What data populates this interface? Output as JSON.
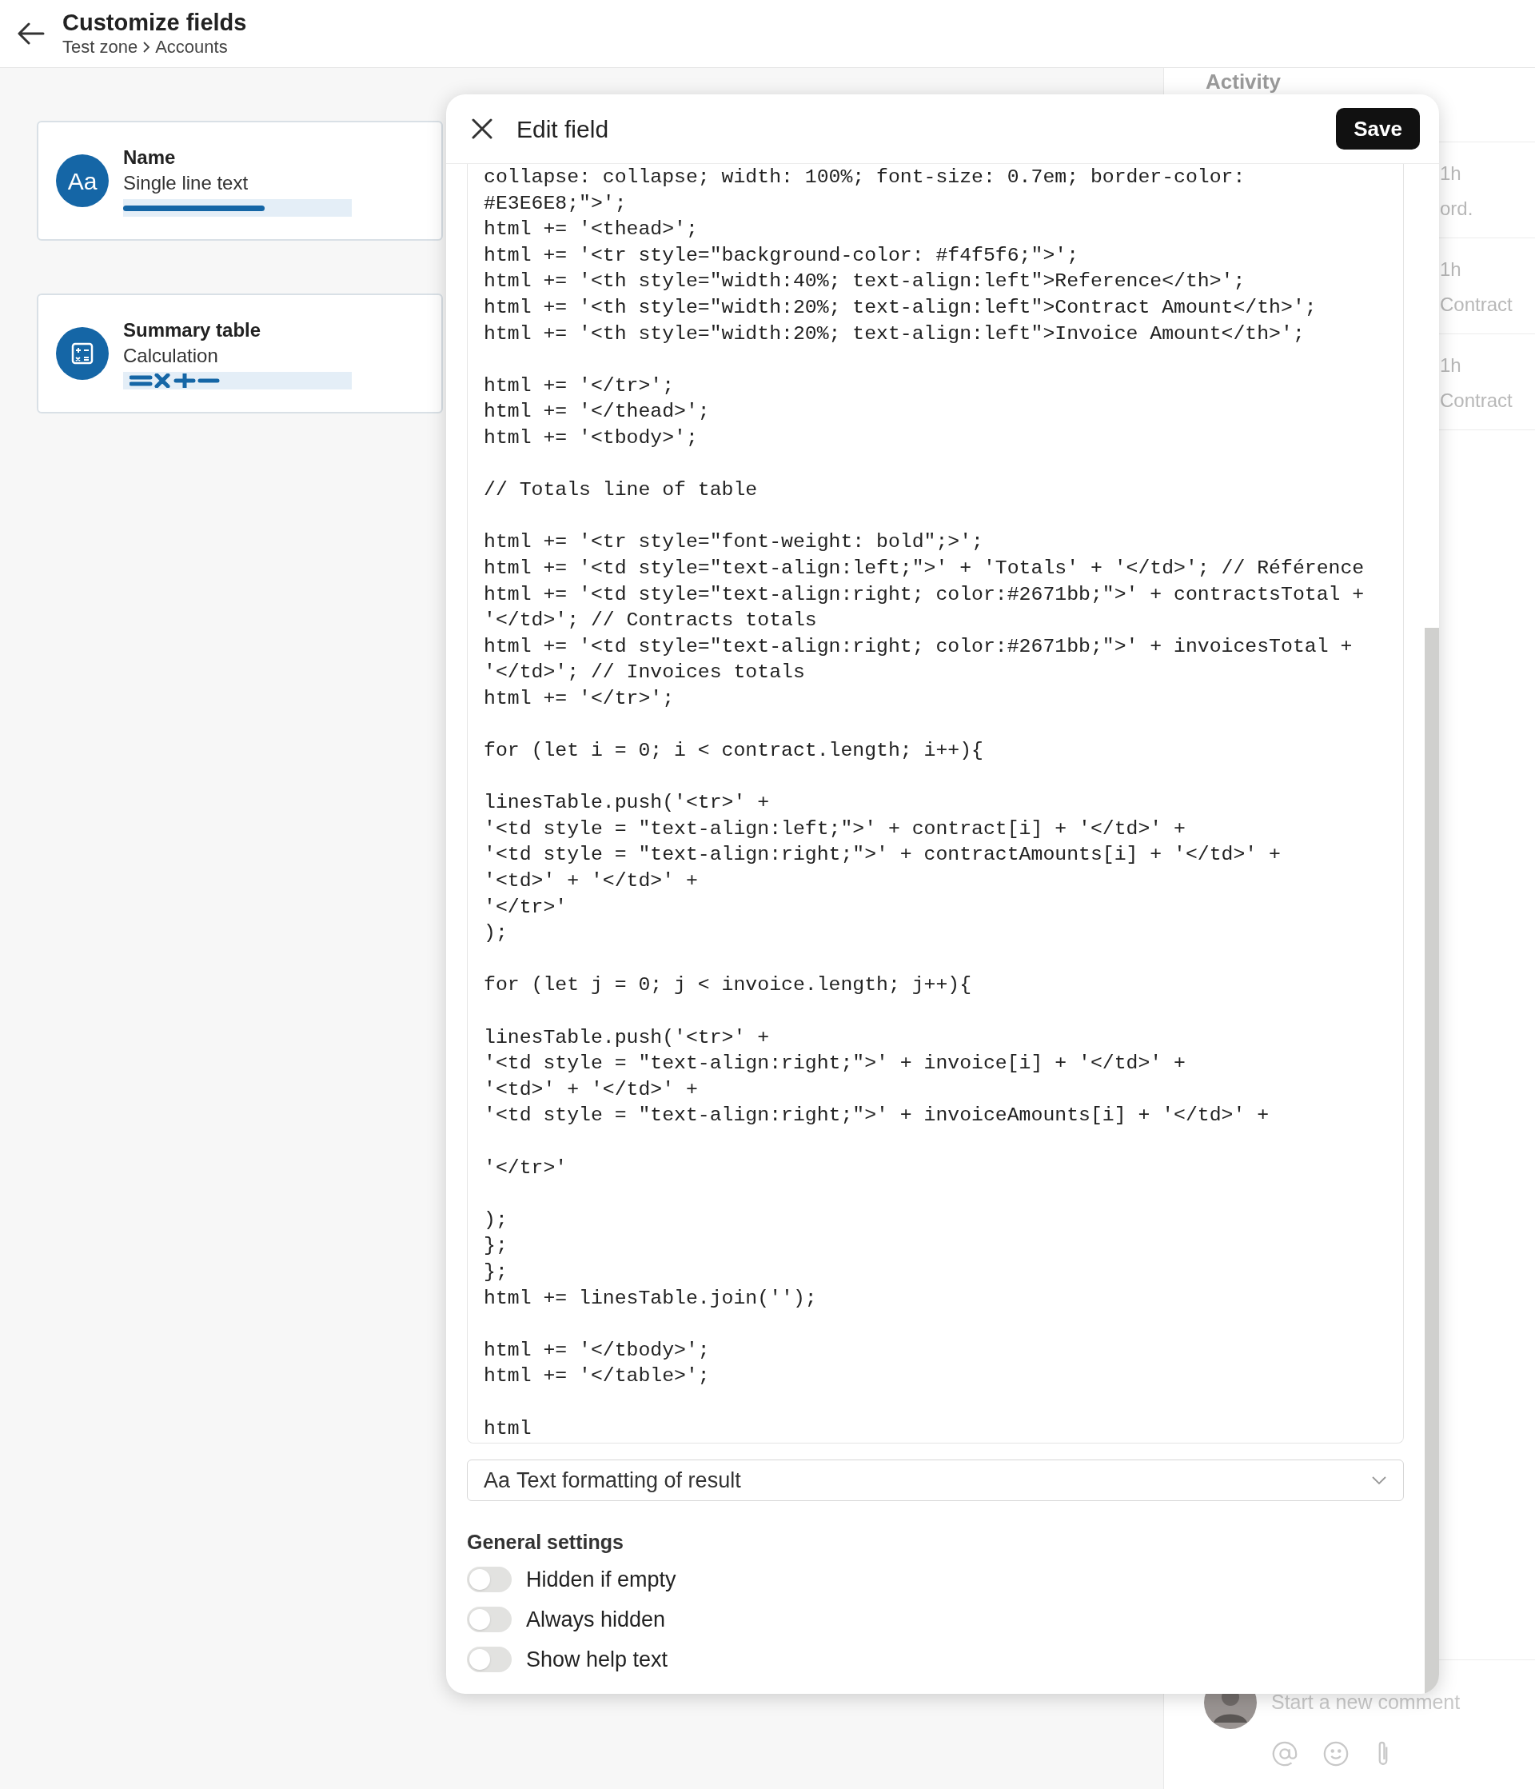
{
  "header": {
    "title": "Customize fields",
    "breadcrumb": [
      "Test zone",
      "Accounts"
    ]
  },
  "field_cards": [
    {
      "kind": "text",
      "icon_text": "Aa",
      "name": "Name",
      "type": "Single line text",
      "level": 0.62
    },
    {
      "kind": "calculation",
      "name": "Summary table",
      "type": "Calculation"
    }
  ],
  "activity": {
    "title": "Activity",
    "entries": [
      {
        "time": "1h",
        "text": "ord."
      },
      {
        "time": "1h",
        "text": "Contract"
      },
      {
        "time": "1h",
        "text": "Contract"
      }
    ],
    "comment": {
      "placeholder": "Start a new comment"
    }
  },
  "dialog": {
    "title": "Edit field",
    "save": "Save",
    "code": "collapse: collapse; width: 100%; font-size: 0.7em; border-color:\n#E3E6E8;\">';\nhtml += '<thead>';\nhtml += '<tr style=\"background-color: #f4f5f6;\">';\nhtml += '<th style=\"width:40%; text-align:left\">Reference</th>';\nhtml += '<th style=\"width:20%; text-align:left\">Contract Amount</th>';\nhtml += '<th style=\"width:20%; text-align:left\">Invoice Amount</th>';\n\nhtml += '</tr>';\nhtml += '</thead>';\nhtml += '<tbody>';\n\n// Totals line of table\n\nhtml += '<tr style=\"font-weight: bold\";>';\nhtml += '<td style=\"text-align:left;\">' + 'Totals' + '</td>'; // Référence\nhtml += '<td style=\"text-align:right; color:#2671bb;\">' + contractsTotal +\n'</td>'; // Contracts totals\nhtml += '<td style=\"text-align:right; color:#2671bb;\">' + invoicesTotal +\n'</td>'; // Invoices totals\nhtml += '</tr>';\n\nfor (let i = 0; i < contract.length; i++){\n\nlinesTable.push('<tr>' +\n'<td style = \"text-align:left;\">' + contract[i] + '</td>' +\n'<td style = \"text-align:right;\">' + contractAmounts[i] + '</td>' +\n'<td>' + '</td>' +\n'</tr>'\n);\n\nfor (let j = 0; j < invoice.length; j++){\n\nlinesTable.push('<tr>' +\n'<td style = \"text-align:right;\">' + invoice[i] + '</td>' +\n'<td>' + '</td>' +\n'<td style = \"text-align:right;\">' + invoiceAmounts[i] + '</td>' +\n\n'</tr>'\n\n);\n};\n};\nhtml += linesTable.join('');\n\nhtml += '</tbody>';\nhtml += '</table>';\n\nhtml",
    "format_select": {
      "icon_text": "Aa",
      "label": "Text formatting of result"
    },
    "settings_title": "General settings",
    "settings": [
      {
        "label": "Hidden if empty",
        "on": false
      },
      {
        "label": "Always hidden",
        "on": false
      },
      {
        "label": "Show help text",
        "on": false
      }
    ]
  }
}
